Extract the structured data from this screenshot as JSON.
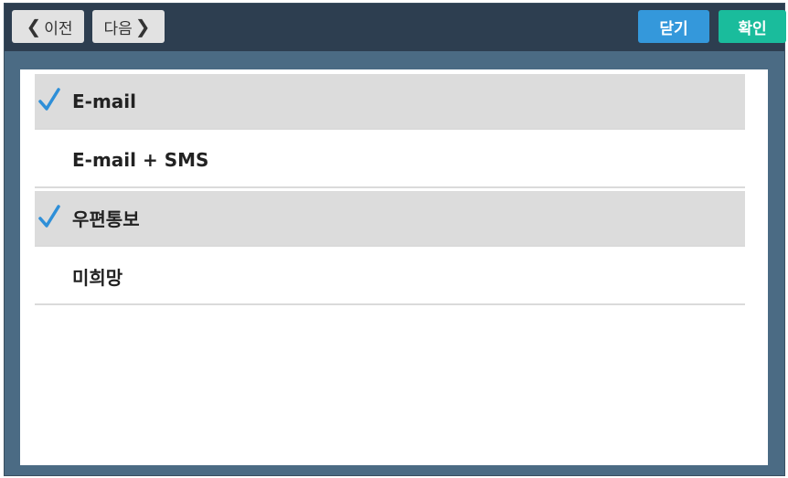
{
  "toolbar": {
    "prev_label": "이전",
    "next_label": "다음",
    "close_label": "닫기",
    "ok_label": "확인",
    "close_color": "#3498db",
    "ok_color": "#1abc9c"
  },
  "options": [
    {
      "label": "E-mail",
      "selected": true
    },
    {
      "label": "E-mail + SMS",
      "selected": false
    },
    {
      "label": "우편통보",
      "selected": true
    },
    {
      "label": "미희망",
      "selected": false
    }
  ],
  "colors": {
    "toolbar_bg": "#2d3e50",
    "frame_bg": "#4b6b84",
    "check": "#2e8fd8",
    "selected_bg": "#dcdcdc"
  }
}
